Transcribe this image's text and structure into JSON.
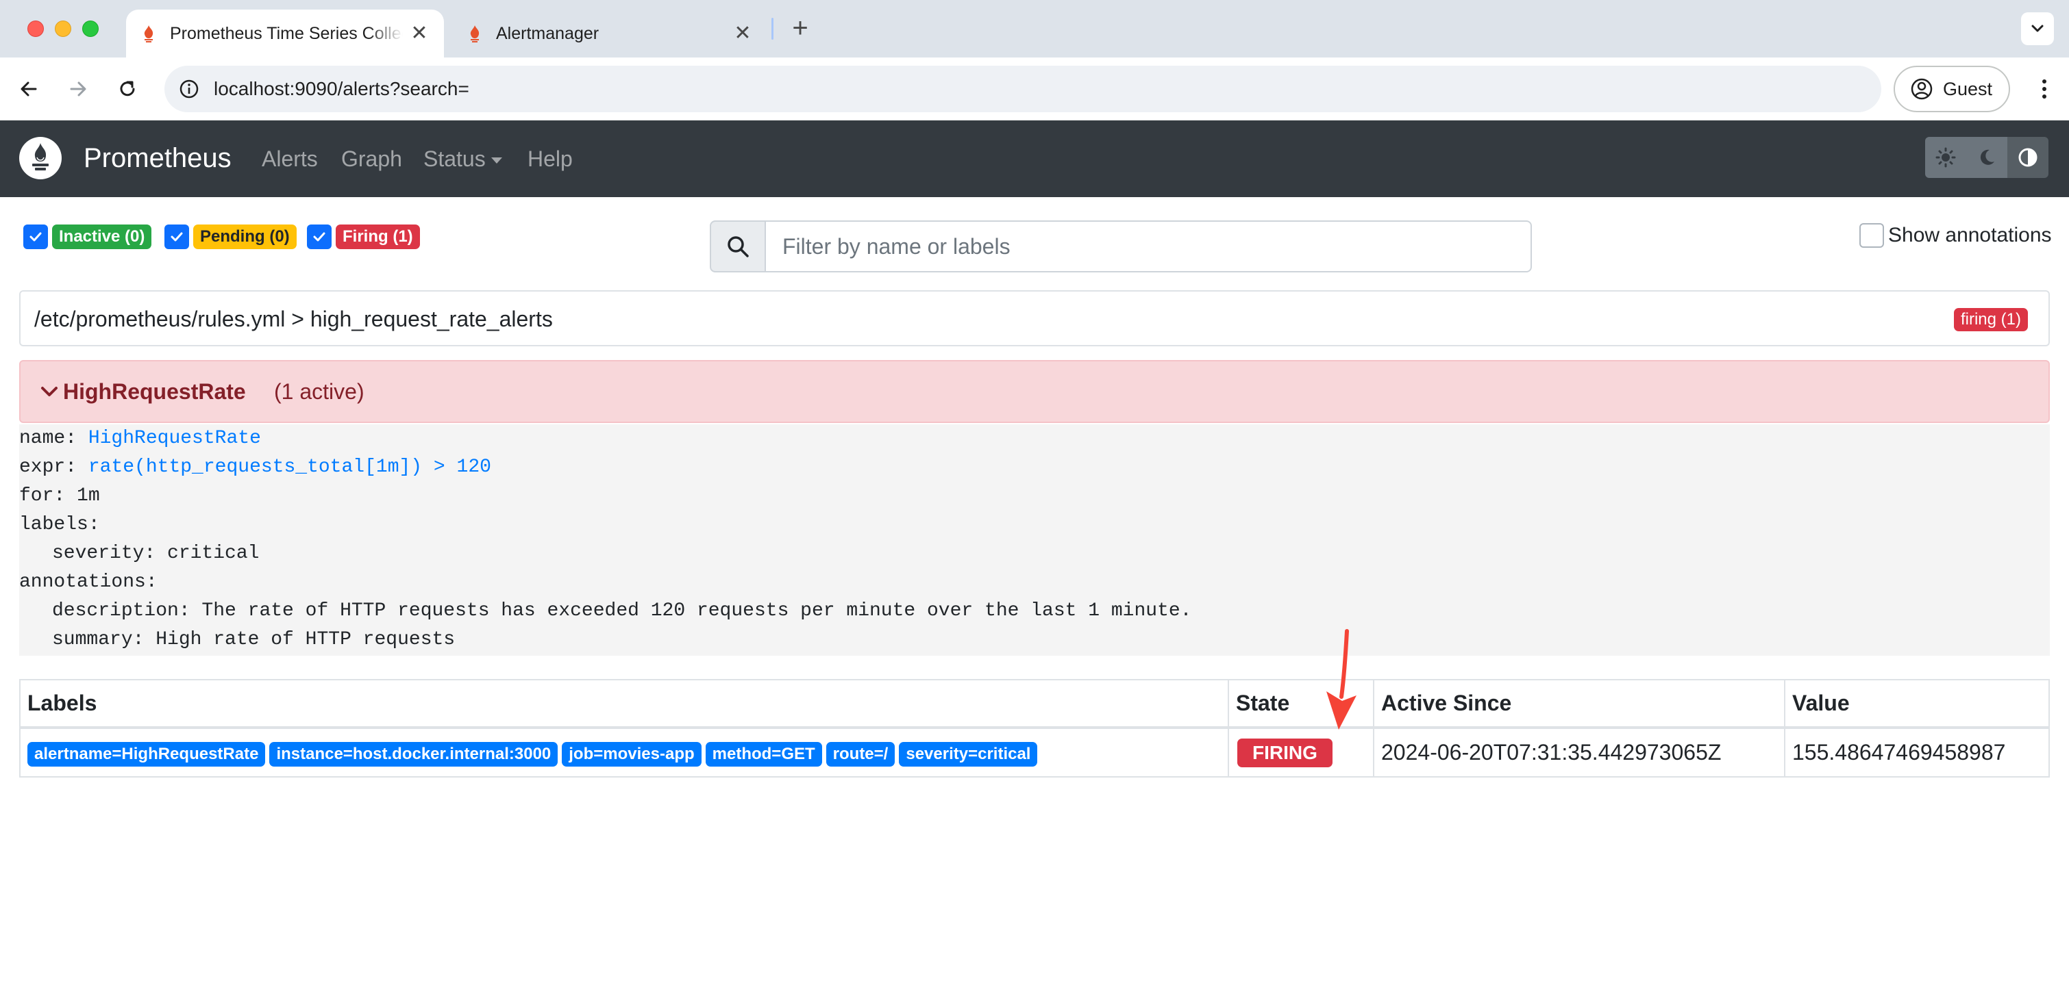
{
  "browser": {
    "tabs": [
      {
        "title": "Prometheus Time Series Collection and Processing Server",
        "active": true
      },
      {
        "title": "Alertmanager",
        "active": false
      }
    ],
    "close_glyph": "✕",
    "new_tab_glyph": "+",
    "url": "localhost:9090/alerts?search=",
    "profile_label": "Guest"
  },
  "navbar": {
    "brand": "Prometheus",
    "links": [
      "Alerts",
      "Graph",
      "Status",
      "Help"
    ],
    "theme_options": [
      "light",
      "dark",
      "auto"
    ],
    "colors": {
      "navbar_bg": "#343a40",
      "primary": "#0d6efd"
    }
  },
  "filters": {
    "inactive": "Inactive (0)",
    "pending": "Pending (0)",
    "firing": "Firing (1)",
    "search_placeholder": "Filter by name or labels",
    "show_annotations": "Show annotations"
  },
  "group": {
    "title": "/etc/prometheus/rules.yml > high_request_rate_alerts",
    "badge": "firing (1)"
  },
  "alert": {
    "name": "HighRequestRate",
    "active_count": "(1 active)",
    "rule": {
      "name_key": "name:",
      "name_val": "HighRequestRate",
      "expr_key": "expr:",
      "expr_val": "rate(http_requests_total[1m]) > 120",
      "for_line": "for: 1m",
      "labels_key": "labels:",
      "severity_line": "severity: critical",
      "annotations_key": "annotations:",
      "description_line": "description: The rate of HTTP requests has exceeded 120 requests per minute over the last 1 minute.",
      "summary_line": "summary: High rate of HTTP requests"
    }
  },
  "table": {
    "headers": [
      "Labels",
      "State",
      "Active Since",
      "Value"
    ],
    "rows": [
      {
        "labels": [
          "alertname=HighRequestRate",
          "instance=host.docker.internal:3000",
          "job=movies-app",
          "method=GET",
          "route=/",
          "severity=critical"
        ],
        "state": "FIRING",
        "active_since": "2024-06-20T07:31:35.442973065Z",
        "value": "155.48647469458987"
      }
    ]
  },
  "annotation_arrow": {
    "color": "#f44336",
    "points_to": "state-firing-badge"
  }
}
